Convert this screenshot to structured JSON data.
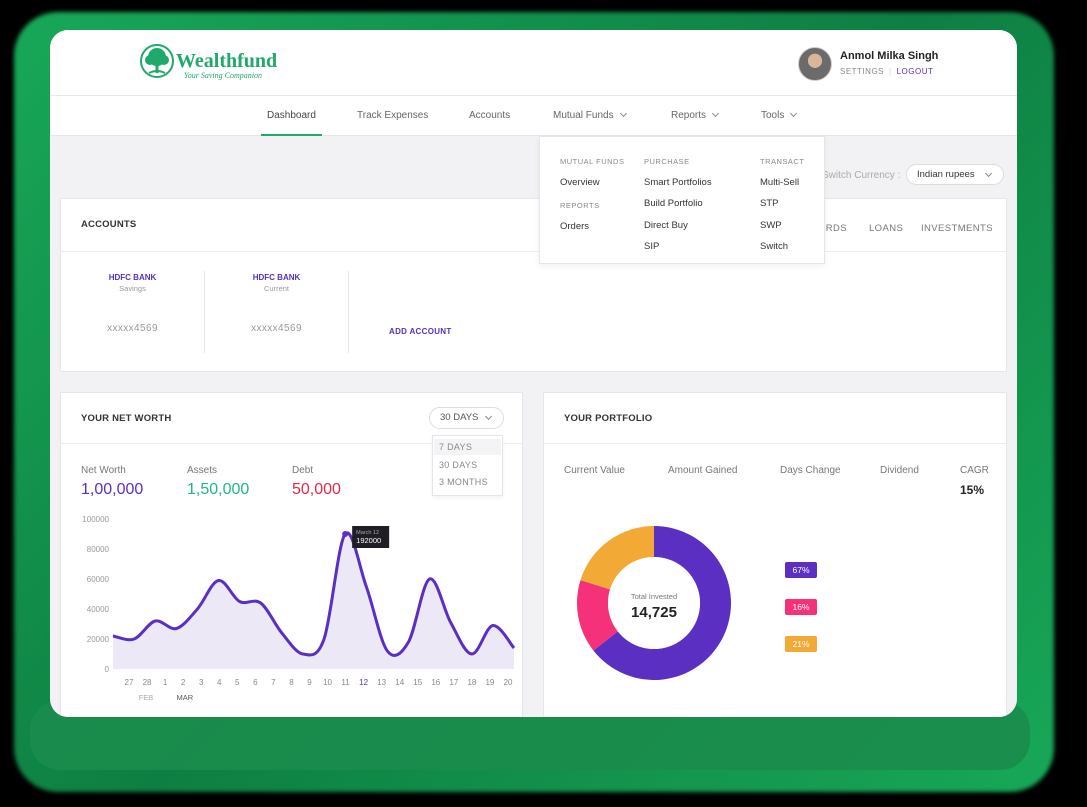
{
  "brand": {
    "name": "Wealthfund",
    "tagline": "Your Saving Companion",
    "color": "#1fa96a"
  },
  "user": {
    "name": "Anmol Milka Singh",
    "settings_label": "SETTINGS",
    "logout_label": "LOGOUT"
  },
  "nav": {
    "items": [
      {
        "label": "Dashboard",
        "active": true
      },
      {
        "label": "Track Expenses"
      },
      {
        "label": "Accounts"
      },
      {
        "label": "Mutual Funds",
        "has_dropdown": true
      },
      {
        "label": "Reports",
        "has_dropdown": true
      },
      {
        "label": "Tools",
        "has_dropdown": true
      }
    ]
  },
  "mega_menu": {
    "mutual_funds_heading": "MUTUAL FUNDS",
    "overview": "Overview",
    "reports_heading": "REPORTS",
    "orders": "Orders",
    "purchase_heading": "PURCHASE",
    "smart_portfolios": "Smart Portfolios",
    "build_portfolio": "Build Portfolio",
    "direct_buy": "Direct Buy",
    "sip": "SIP",
    "transact_heading": "TRANSACT",
    "multi_sell": "Multi-Sell",
    "stp": "STP",
    "swp": "SWP",
    "switch": "Switch"
  },
  "currency": {
    "label": "Switch Currency :",
    "selected": "Indian rupees"
  },
  "accounts_card": {
    "title": "ACCOUNTS",
    "tabs": [
      "ARDS",
      "LOANS",
      "INVESTMENTS"
    ],
    "accounts": [
      {
        "bank": "HDFC BANK",
        "type": "Savings",
        "number": "xxxxx4569"
      },
      {
        "bank": "HDFC BANK",
        "type": "Current",
        "number": "xxxxx4569"
      }
    ],
    "add_label": "ADD ACCOUNT"
  },
  "net_worth": {
    "title": "YOUR NET WORTH",
    "range_selected": "30 DAYS",
    "range_options": [
      "7 DAYS",
      "30 DAYS",
      "3 MONTHS"
    ],
    "stats": [
      {
        "label": "Net Worth",
        "value": "1,00,000",
        "color": "#5a2fc2"
      },
      {
        "label": "Assets",
        "value": "1,50,000",
        "color": "#1fb886"
      },
      {
        "label": "Debt",
        "value": "50,000",
        "color": "#e8284a"
      }
    ]
  },
  "chart_data": {
    "type": "area",
    "x": [
      "27",
      "28",
      "1",
      "2",
      "3",
      "4",
      "5",
      "6",
      "7",
      "8",
      "9",
      "10",
      "11",
      "12",
      "13",
      "14",
      "15",
      "16",
      "17",
      "18",
      "19",
      "20"
    ],
    "month_labels": [
      "FEB",
      "MAR"
    ],
    "values": [
      22000,
      20000,
      32000,
      27000,
      40000,
      59000,
      45000,
      44000,
      24000,
      10000,
      20000,
      90000,
      55000,
      12000,
      18000,
      60000,
      31000,
      10000,
      29000,
      14000
    ],
    "y_ticks": [
      "100000",
      "80000",
      "60000",
      "40000",
      "20000",
      "0"
    ],
    "ylim": [
      0,
      100000
    ],
    "tooltip": {
      "date": "March 12",
      "value": "192000"
    },
    "line_color": "#5a2fc2",
    "fill_color": "#ece8f6"
  },
  "portfolio": {
    "title": "YOUR PORTFOLIO",
    "columns": [
      {
        "label": "Current Value",
        "value": ""
      },
      {
        "label": "Amount Gained",
        "value": ""
      },
      {
        "label": "Days Change",
        "value": ""
      },
      {
        "label": "Dividend",
        "value": ""
      },
      {
        "label": "CAGR",
        "value": "15%"
      }
    ],
    "total_label": "Total Invested",
    "total_value": "14,725",
    "slices": [
      {
        "label": "67%",
        "value": 67,
        "color": "#5a2fc2"
      },
      {
        "label": "16%",
        "value": 16,
        "color": "#f5317a"
      },
      {
        "label": "21%",
        "value": 21,
        "color": "#f2a935"
      }
    ]
  }
}
